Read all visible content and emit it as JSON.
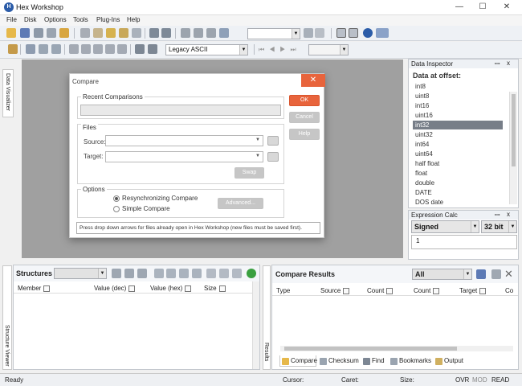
{
  "window": {
    "title": "Hex Workshop",
    "icon_letter": "H",
    "minimize": "—",
    "maximize": "☐",
    "close": "✕"
  },
  "menu": [
    "File",
    "Disk",
    "Options",
    "Tools",
    "Plug-Ins",
    "Help"
  ],
  "toolbar": {
    "encoding": "Legacy ASCII"
  },
  "sidebar_left": {
    "data_visualizer": "Data Visualizer",
    "structure_viewer": "Structure Viewer",
    "results": "Results"
  },
  "compare_dialog": {
    "title": "Compare",
    "close": "✕",
    "recent_label": "Recent Comparisons",
    "files_label": "Files",
    "source_label": "Source:",
    "target_label": "Target:",
    "swap": "Swap",
    "options_label": "Options",
    "resync": "Resynchronizing Compare",
    "simple": "Simple Compare",
    "advanced": "Advanced...",
    "ok": "OK",
    "cancel": "Cancel",
    "help": "Help",
    "hint": "Press drop down arrows for files already open in Hex Workshop (new files must be saved first)."
  },
  "data_inspector": {
    "title": "Data Inspector",
    "pin": "ꟷ",
    "close": "x",
    "heading": "Data at offset:",
    "items": [
      "int8",
      "uint8",
      "int16",
      "uint16",
      "int32",
      "uint32",
      "int64",
      "uint64",
      "half float",
      "float",
      "double",
      "DATE",
      "DOS date"
    ],
    "selected": "int32"
  },
  "expression_calc": {
    "title": "Expression Calc",
    "pin": "ꟷ",
    "close": "x",
    "sign": "Signed",
    "bits": "32 bit",
    "value": "1"
  },
  "structures": {
    "title": "Structures",
    "columns": [
      "Member",
      "Value (dec)",
      "Value (hex)",
      "Size"
    ]
  },
  "compare_results": {
    "title": "Compare Results",
    "filter": "All",
    "close": "✕",
    "columns": [
      "Type",
      "Source",
      "Count",
      "Count",
      "Target",
      "Co"
    ]
  },
  "bottom_tabs": [
    "Compare",
    "Checksum",
    "Find",
    "Bookmarks",
    "Output"
  ],
  "status": {
    "ready": "Ready",
    "cursor": "Cursor:",
    "caret": "Caret:",
    "size": "Size:",
    "ovr": "OVR",
    "mod": "MOD",
    "read": "READ"
  },
  "colors": {
    "accent": "#e8643c",
    "toolbar_bg": "#eef1f5",
    "workarea": "#a0a0a0",
    "selected_row": "#777e88"
  }
}
